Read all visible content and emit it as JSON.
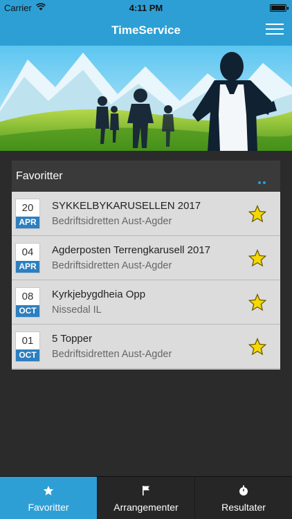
{
  "status": {
    "carrier": "Carrier",
    "time": "4:11 PM"
  },
  "nav": {
    "title": "TimeService",
    "menu_icon": "hamburger-menu-icon"
  },
  "favorites": {
    "title": "Favoritter",
    "events": [
      {
        "day": "20",
        "month": "APR",
        "title": "SYKKELBYKARUSELLEN 2017",
        "org": "Bedriftsidretten Aust-Agder"
      },
      {
        "day": "04",
        "month": "APR",
        "title": "Agderposten Terrengkarusell 2017",
        "org": "Bedriftsidretten Aust-Agder"
      },
      {
        "day": "08",
        "month": "OCT",
        "title": "Kyrkjebygdheia Opp",
        "org": "Nissedal IL"
      },
      {
        "day": "01",
        "month": "OCT",
        "title": "5 Topper",
        "org": "Bedriftsidretten Aust-Agder"
      }
    ]
  },
  "tabs": [
    {
      "label": "Favoritter",
      "icon": "star-icon",
      "active": true
    },
    {
      "label": "Arrangementer",
      "icon": "flag-icon",
      "active": false
    },
    {
      "label": "Resultater",
      "icon": "stopwatch-icon",
      "active": false
    }
  ],
  "colors": {
    "accent": "#2d9fd5",
    "date_month_bg": "#2d7fc0",
    "star": "#f5d800"
  }
}
